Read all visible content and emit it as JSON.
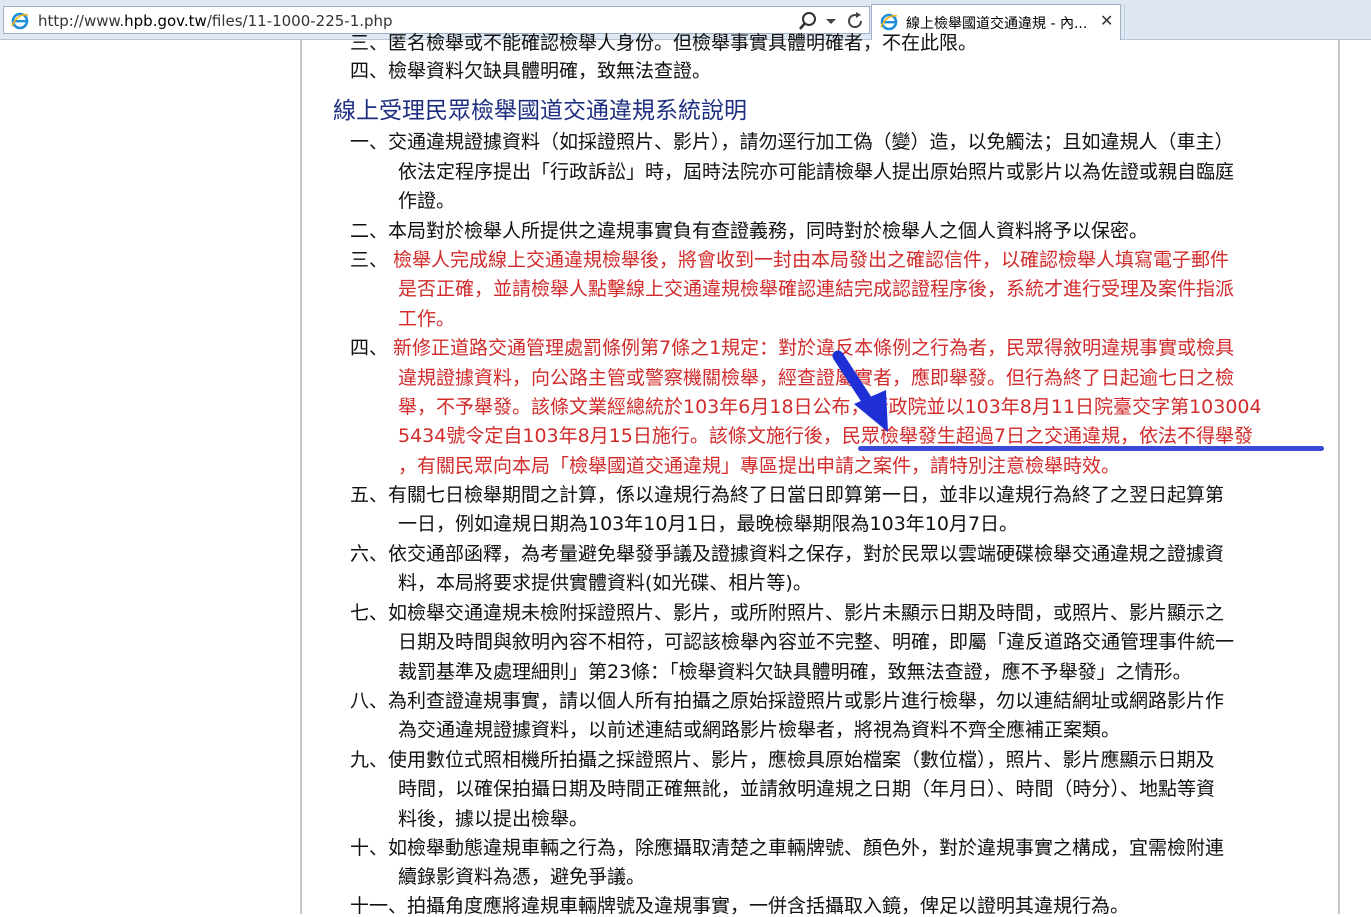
{
  "browser": {
    "url_prefix": "http://www.",
    "url_host": "hpb.gov.tw",
    "url_path": "/files/11-1000-225-1.php",
    "tab_title": "線上檢舉國道交通違規 - 內...",
    "tab_close": "✕"
  },
  "page": {
    "top_partial_line": "三、匿名檢舉或不能確認檢舉人身份。但檢舉事實具體明確者，不在此限。",
    "top_line_4": "四、檢舉資料欠缺具體明確，致無法查證。",
    "section_title": "線上受理民眾檢舉國道交通違規系統說明",
    "items": [
      {
        "lines": [
          "一、交通違規證據資料（如採證照片、影片），請勿逕行加工偽（變）造，以免觸法；且如違規人（車主）",
          "依法定程序提出「行政訴訟」時，屆時法院亦可能請檢舉人提出原始照片或影片以為佐證或親自臨庭",
          "作證。"
        ]
      },
      {
        "lines": [
          "二、本局對於檢舉人所提供之違規事實負有查證義務，同時對於檢舉人之個人資料將予以保密。"
        ]
      },
      {
        "lines": [
          "檢舉人完成線上交通違規檢舉後，將會收到一封由本局發出之確認信件，以確認檢舉人填寫電子郵件",
          "是否正確，並請檢舉人點擊線上交通違規檢舉確認連結完成認證程序後，系統才進行受理及案件指派",
          "工作。"
        ],
        "prefix": "三、"
      },
      {
        "prefix": "四、",
        "lines": [
          "新修正道路交通管理處罰條例第7條之1規定：對於違反本條例之行為者，民眾得敘明違規事實或檢具",
          "違規證據資料，向公路主管或警察機關檢舉，經查證屬實者，應即舉發。但行為終了日起逾七日之檢",
          "舉，不予舉發。該條文業經總統於103年6月18日公布，行政院並以103年8月11日院臺交字第103004",
          "5434號令定自103年8月15日施行。該條文施行後，民眾檢舉發生超過7日之交通違規，依法不得舉發",
          "，有關民眾向本局「檢舉國道交通違規」專區提出申請之案件，請特別注意檢舉時效。"
        ]
      },
      {
        "lines": [
          "五、有關七日檢舉期間之計算，係以違規行為終了日當日即算第一日，並非以違規行為終了之翌日起算第",
          "一日，例如違規日期為103年10月1日，最晚檢舉期限為103年10月7日。"
        ]
      },
      {
        "lines": [
          "六、依交通部函釋，為考量避免舉發爭議及證據資料之保存，對於民眾以雲端硬碟檢舉交通違規之證據資",
          "料，本局將要求提供實體資料(如光碟、相片等)。"
        ]
      },
      {
        "lines": [
          "七、如檢舉交通違規未檢附採證照片、影片，或所附照片、影片未顯示日期及時間，或照片、影片顯示之",
          "日期及時間與敘明內容不相符，可認該檢舉內容並不完整、明確，即屬「違反道路交通管理事件統一",
          "裁罰基準及處理細則」第23條：「檢舉資料欠缺具體明確，致無法查證，應不予舉發」之情形。"
        ]
      },
      {
        "lines": [
          "八、為利查證違規事實，請以個人所有拍攝之原始採證照片或影片進行檢舉，勿以連結網址或網路影片作",
          "為交通違規證據資料，以前述連結或網路影片檢舉者，將視為資料不齊全應補正案類。"
        ]
      },
      {
        "lines": [
          "九、使用數位式照相機所拍攝之採證照片、影片，應檢具原始檔案（數位檔），照片、影片應顯示日期及",
          "時間，以確保拍攝日期及時間正確無訛，並請敘明違規之日期（年月日）、時間（時分）、地點等資",
          "料後，據以提出檢舉。"
        ]
      },
      {
        "lines": [
          "十、如檢舉動態違規車輛之行為，除應攝取清楚之車輛牌號、顏色外，對於違規事實之構成，宜需檢附連",
          "續錄影資料為憑，避免爭議。"
        ]
      },
      {
        "lines": [
          "十一、拍攝角度應將違規車輛牌號及違規事實，一併含括攝取入鏡，俾足以證明其違規行為。"
        ]
      }
    ]
  },
  "colors": {
    "text": "#111111",
    "red_text": "#d12b2b",
    "heading": "#1f2f80",
    "annotation_blue": "#2233dd"
  },
  "icons": [
    "ie-logo-icon",
    "search-icon",
    "chevron-down-icon",
    "refresh-icon",
    "close-icon",
    "arrow-annotation-icon"
  ]
}
